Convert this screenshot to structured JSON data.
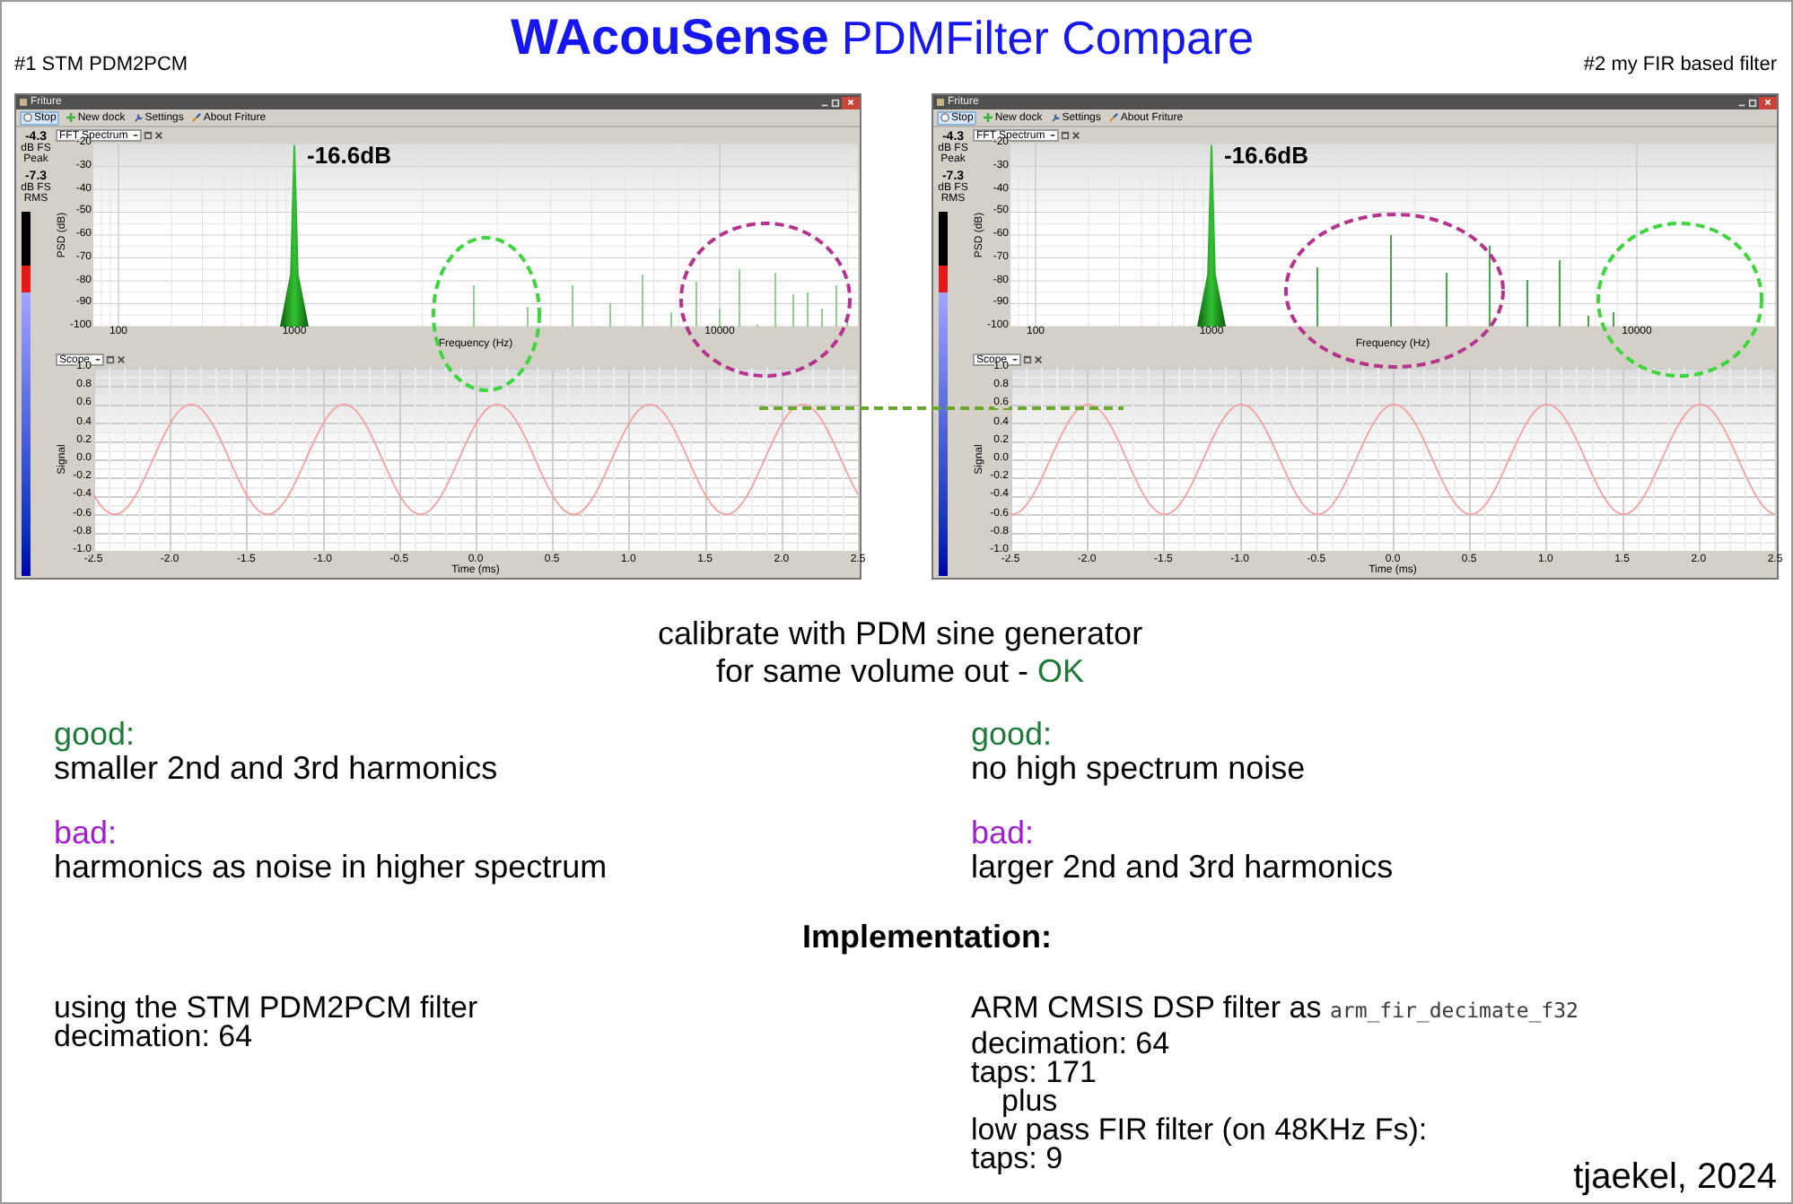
{
  "title": {
    "brand": "WAcouSense",
    "subtitle": "PDMFilter Compare"
  },
  "panels": [
    {
      "caption": "#1 STM PDM2PCM",
      "window": {
        "title": "Friture",
        "toolbar": [
          {
            "kind": "stop",
            "label": "Stop",
            "selected": true
          },
          {
            "kind": "new-dock",
            "label": "New dock",
            "selected": false
          },
          {
            "kind": "settings",
            "label": "Settings",
            "selected": false
          },
          {
            "kind": "about",
            "label": "About Friture",
            "selected": false
          }
        ],
        "meter": {
          "peak": "-4.3",
          "peak_unit": "dB FS",
          "peak_label": "Peak",
          "rms": "-7.3",
          "rms_unit": "dB FS",
          "rms_label": "RMS",
          "bars": [
            {
              "kind": "peak",
              "level": 0.85
            },
            {
              "kind": "rms",
              "level": 0.78
            }
          ]
        },
        "spectrum": {
          "dock": "FFT Spectrum",
          "ylabel": "PSD (dB)",
          "xlabel": "Frequency (Hz)",
          "yticks": [
            "-20",
            "-30",
            "-40",
            "-50",
            "-60",
            "-70",
            "-80",
            "-90",
            "-100"
          ],
          "xticks": [
            "100",
            "1000",
            "10000"
          ],
          "annotation": "-16.6dB"
        },
        "scope": {
          "dock": "Scope",
          "ylabel": "Signal",
          "xlabel": "Time (ms)",
          "yticks": [
            "1.0",
            "0.8",
            "0.6",
            "0.4",
            "0.2",
            "0.0",
            "-0.2",
            "-0.4",
            "-0.6",
            "-0.8",
            "-1.0"
          ],
          "xticks": [
            "-2.5",
            "-2.0",
            "-1.5",
            "-1.0",
            "-0.5",
            "0.0",
            "0.5",
            "1.0",
            "1.5",
            "2.0",
            "2.5"
          ]
        }
      }
    },
    {
      "caption": "#2 my FIR based filter",
      "window": {
        "title": "Friture",
        "toolbar": [
          {
            "kind": "stop",
            "label": "Stop",
            "selected": true
          },
          {
            "kind": "new-dock",
            "label": "New dock",
            "selected": false
          },
          {
            "kind": "settings",
            "label": "Settings",
            "selected": false
          },
          {
            "kind": "about",
            "label": "About Friture",
            "selected": false
          }
        ],
        "meter": {
          "peak": "-4.3",
          "peak_unit": "dB FS",
          "peak_label": "Peak",
          "rms": "-7.3",
          "rms_unit": "dB FS",
          "rms_label": "RMS",
          "bars": [
            {
              "kind": "peak",
              "level": 0.85
            },
            {
              "kind": "rms",
              "level": 0.78
            }
          ]
        },
        "spectrum": {
          "dock": "FFT Spectrum",
          "ylabel": "PSD (dB)",
          "xlabel": "Frequency (Hz)",
          "yticks": [
            "-20",
            "-30",
            "-40",
            "-50",
            "-60",
            "-70",
            "-80",
            "-90",
            "-100"
          ],
          "xticks": [
            "100",
            "1000",
            "10000"
          ],
          "annotation": "-16.6dB"
        },
        "scope": {
          "dock": "Scope",
          "ylabel": "Signal",
          "xlabel": "Time (ms)",
          "yticks": [
            "1.0",
            "0.8",
            "0.6",
            "0.4",
            "0.2",
            "0.0",
            "-0.2",
            "-0.4",
            "-0.6",
            "-0.8",
            "-1.0"
          ],
          "xticks": [
            "-2.5",
            "-2.0",
            "-1.5",
            "-1.0",
            "-0.5",
            "0.0",
            "0.5",
            "1.0",
            "1.5",
            "2.0",
            "2.5"
          ]
        }
      }
    }
  ],
  "calibration": {
    "lines": [
      "calibrate with PDM sine generator",
      "for same volume out -"
    ],
    "status": "OK"
  },
  "verdict_columns": [
    [
      {
        "label": "good:",
        "color": "#1f7a3a",
        "text": "smaller 2nd and 3rd harmonics"
      },
      {
        "label": "bad:",
        "color": "#a01ecf",
        "text": "harmonics as noise in higher spectrum"
      }
    ],
    [
      {
        "label": "good:",
        "color": "#1f7a3a",
        "text": "no high spectrum noise"
      },
      {
        "label": "bad:",
        "color": "#a01ecf",
        "text": "larger 2nd and 3rd harmonics"
      }
    ]
  ],
  "implementation": {
    "heading": "Implementation:",
    "columns": [
      [
        {
          "text": "using the STM PDM2PCM filter"
        },
        {
          "text": "decimation: 64"
        }
      ],
      [
        {
          "text": "ARM CMSIS DSP filter as",
          "code": "arm_fir_decimate_f32"
        },
        {
          "text": "decimation: 64"
        },
        {
          "text": "taps: 171",
          "children": [
            {
              "text": "plus"
            }
          ]
        },
        {
          "text": "low pass FIR filter (on 48KHz Fs):"
        },
        {
          "text": "taps: 9"
        }
      ]
    ]
  },
  "signature": "tjaekel, 2024"
}
